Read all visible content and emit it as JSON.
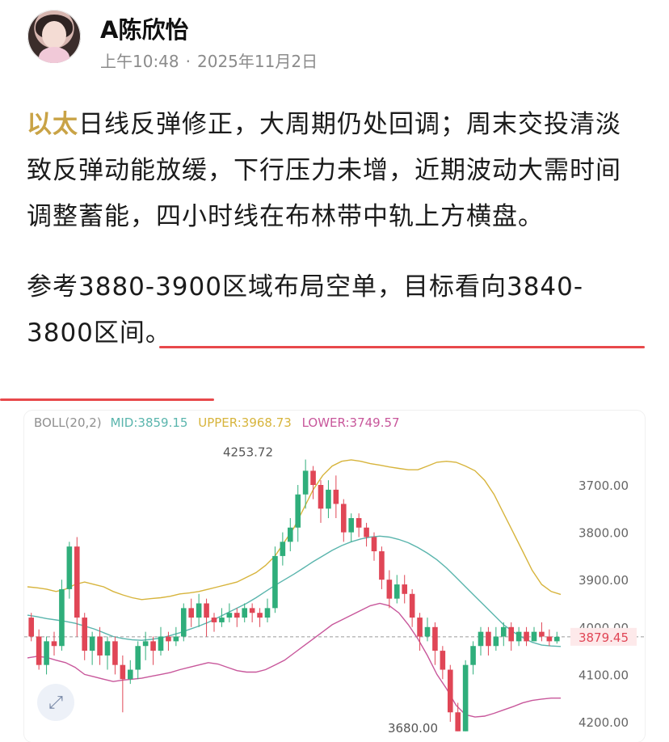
{
  "author": {
    "name": "A陈欣怡",
    "time": "上午10:48",
    "separator": "·",
    "date": "2025年11月2日"
  },
  "post": {
    "tag": "以太",
    "para1": "日线反弹修正，大周期仍处回调；周末交投清淡致反弹动能放缓，下行压力未增，近期波动大需时间调整蓄能，四小时线在布林带中轨上方横盘。",
    "para2": "参考3880-3900区域布局空单，目标看向3840-3800区间。"
  },
  "chart": {
    "indicator": "BOLL(20,2)",
    "mid_label": "MID:3859.15",
    "upper_label": "UPPER:3968.73",
    "lower_label": "LOWER:3749.57",
    "high_label": "4253.72",
    "low_label": "3680.00",
    "current_price": "3879.45",
    "y_ticks": [
      "4200.00",
      "4100.00",
      "4000.00",
      "3900.00",
      "3800.00",
      "3700.00"
    ],
    "colors": {
      "up": "#2fae7b",
      "down": "#e04656",
      "mid": "#5ab5ad",
      "upper": "#d7b43c",
      "lower": "#c8579b",
      "underline": "#e8494b",
      "tag": "#c9a346"
    }
  },
  "chart_data": {
    "type": "candlestick",
    "title": "",
    "indicator": "BOLL(20,2)",
    "ylim": [
      3675,
      4265
    ],
    "y_ticks": [
      3700,
      3800,
      3900,
      4000,
      4100,
      4200
    ],
    "current_price": 3879.45,
    "high_marker": 4253.72,
    "low_marker": 3680.0,
    "candles": [
      [
        3920,
        3880,
        3930,
        3870
      ],
      [
        3880,
        3820,
        3895,
        3810
      ],
      [
        3820,
        3870,
        3880,
        3800
      ],
      [
        3870,
        3860,
        3890,
        3840
      ],
      [
        3860,
        3980,
        4000,
        3850
      ],
      [
        3980,
        4070,
        4080,
        3960
      ],
      [
        4070,
        3920,
        4090,
        3880
      ],
      [
        3920,
        3850,
        3930,
        3830
      ],
      [
        3850,
        3880,
        3890,
        3820
      ],
      [
        3880,
        3840,
        3900,
        3820
      ],
      [
        3840,
        3870,
        3880,
        3810
      ],
      [
        3870,
        3820,
        3880,
        3800
      ],
      [
        3820,
        3790,
        3840,
        3720
      ],
      [
        3790,
        3810,
        3830,
        3780
      ],
      [
        3810,
        3860,
        3870,
        3790
      ],
      [
        3860,
        3870,
        3890,
        3830
      ],
      [
        3870,
        3850,
        3880,
        3820
      ],
      [
        3850,
        3880,
        3900,
        3840
      ],
      [
        3880,
        3870,
        3890,
        3850
      ],
      [
        3870,
        3880,
        3900,
        3860
      ],
      [
        3880,
        3940,
        3950,
        3870
      ],
      [
        3940,
        3920,
        3960,
        3900
      ],
      [
        3920,
        3950,
        3970,
        3900
      ],
      [
        3950,
        3920,
        3960,
        3880
      ],
      [
        3920,
        3910,
        3930,
        3890
      ],
      [
        3910,
        3920,
        3940,
        3900
      ],
      [
        3920,
        3930,
        3950,
        3910
      ],
      [
        3930,
        3920,
        3940,
        3900
      ],
      [
        3920,
        3940,
        3950,
        3910
      ],
      [
        3940,
        3930,
        3950,
        3910
      ],
      [
        3930,
        3920,
        3940,
        3900
      ],
      [
        3920,
        3940,
        3960,
        3910
      ],
      [
        3940,
        4050,
        4070,
        3930
      ],
      [
        4050,
        4080,
        4100,
        4030
      ],
      [
        4080,
        4110,
        4130,
        4060
      ],
      [
        4110,
        4180,
        4200,
        4080
      ],
      [
        4180,
        4230,
        4253.72,
        4150
      ],
      [
        4230,
        4200,
        4240,
        4170
      ],
      [
        4200,
        4150,
        4210,
        4120
      ],
      [
        4150,
        4190,
        4210,
        4130
      ],
      [
        4190,
        4160,
        4220,
        4130
      ],
      [
        4160,
        4100,
        4170,
        4080
      ],
      [
        4100,
        4130,
        4140,
        4080
      ],
      [
        4130,
        4110,
        4140,
        4090
      ],
      [
        4110,
        4090,
        4120,
        4070
      ],
      [
        4090,
        4060,
        4100,
        4040
      ],
      [
        4060,
        4000,
        4070,
        3980
      ],
      [
        4000,
        3960,
        4020,
        3940
      ],
      [
        3960,
        3990,
        4010,
        3950
      ],
      [
        3990,
        3970,
        4010,
        3950
      ],
      [
        3970,
        3920,
        3980,
        3900
      ],
      [
        3920,
        3880,
        3930,
        3850
      ],
      [
        3880,
        3900,
        3920,
        3870
      ],
      [
        3900,
        3850,
        3910,
        3820
      ],
      [
        3850,
        3810,
        3860,
        3790
      ],
      [
        3810,
        3720,
        3820,
        3700
      ],
      [
        3720,
        3680,
        3740,
        3680
      ],
      [
        3680,
        3820,
        3830,
        3680
      ],
      [
        3820,
        3860,
        3870,
        3800
      ],
      [
        3860,
        3890,
        3900,
        3840
      ],
      [
        3890,
        3860,
        3900,
        3840
      ],
      [
        3860,
        3880,
        3900,
        3850
      ],
      [
        3880,
        3900,
        3910,
        3860
      ],
      [
        3900,
        3870,
        3910,
        3850
      ],
      [
        3870,
        3890,
        3900,
        3860
      ],
      [
        3890,
        3870,
        3900,
        3860
      ],
      [
        3870,
        3890,
        3900,
        3870
      ],
      [
        3890,
        3880,
        3910,
        3870
      ],
      [
        3880,
        3870,
        3895,
        3860
      ],
      [
        3870,
        3879.45,
        3890,
        3865
      ]
    ],
    "series": [
      {
        "name": "UPPER",
        "values": [
          3985,
          3983,
          3980,
          3975,
          3980,
          3990,
          3995,
          3990,
          3985,
          3975,
          3968,
          3962,
          3958,
          3960,
          3962,
          3965,
          3970,
          3972,
          3975,
          3980,
          3985,
          3990,
          3995,
          4005,
          4015,
          4030,
          4050,
          4080,
          4110,
          4150,
          4190,
          4220,
          4240,
          4250,
          4253,
          4250,
          4245,
          4242,
          4238,
          4235,
          4232,
          4232,
          4240,
          4248,
          4250,
          4248,
          4240,
          4230,
          4210,
          4180,
          4140,
          4100,
          4060,
          4020,
          3990,
          3975,
          3969
        ]
      },
      {
        "name": "MID",
        "values": [
          3925,
          3922,
          3918,
          3915,
          3912,
          3908,
          3902,
          3896,
          3888,
          3880,
          3876,
          3873,
          3872,
          3874,
          3877,
          3882,
          3888,
          3895,
          3902,
          3910,
          3920,
          3930,
          3940,
          3950,
          3962,
          3975,
          3988,
          4000,
          4012,
          4025,
          4038,
          4050,
          4062,
          4072,
          4080,
          4086,
          4090,
          4092,
          4090,
          4085,
          4078,
          4068,
          4056,
          4042,
          4025,
          4005,
          3985,
          3965,
          3945,
          3925,
          3905,
          3890,
          3878,
          3868,
          3862,
          3860,
          3859
        ]
      },
      {
        "name": "LOWER",
        "values": [
          3835,
          3838,
          3836,
          3830,
          3825,
          3815,
          3800,
          3795,
          3790,
          3785,
          3788,
          3790,
          3792,
          3796,
          3800,
          3804,
          3810,
          3815,
          3820,
          3825,
          3822,
          3815,
          3808,
          3805,
          3805,
          3810,
          3820,
          3830,
          3845,
          3860,
          3875,
          3890,
          3905,
          3915,
          3925,
          3935,
          3945,
          3950,
          3945,
          3930,
          3905,
          3875,
          3840,
          3800,
          3770,
          3735,
          3715,
          3710,
          3712,
          3718,
          3725,
          3732,
          3740,
          3745,
          3748,
          3750,
          3750
        ]
      }
    ]
  }
}
